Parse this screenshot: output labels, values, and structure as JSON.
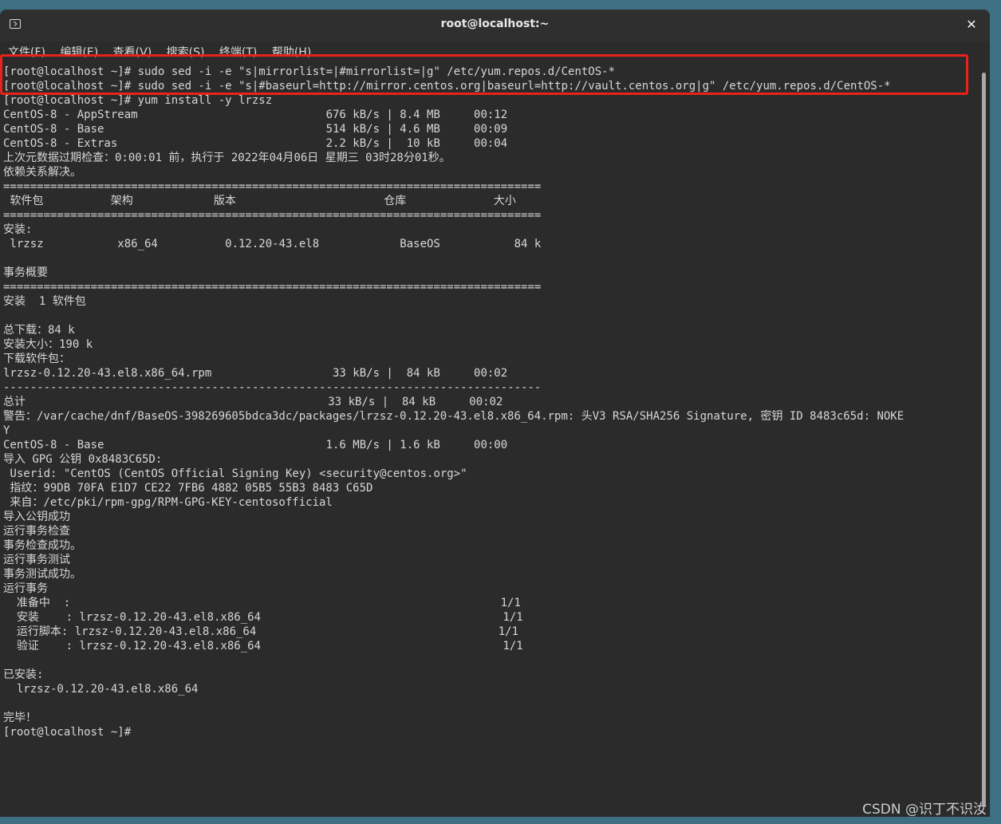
{
  "window": {
    "title": "root@localhost:~",
    "close_glyph": "✕"
  },
  "menu": [
    "文件(F)",
    "编辑(E)",
    "查看(V)",
    "搜索(S)",
    "终端(T)",
    "帮助(H)"
  ],
  "terminal": {
    "lines": [
      "[root@localhost ~]# sudo sed -i -e \"s|mirrorlist=|#mirrorlist=|g\" /etc/yum.repos.d/CentOS-*",
      "[root@localhost ~]# sudo sed -i -e \"s|#baseurl=http://mirror.centos.org|baseurl=http://vault.centos.org|g\" /etc/yum.repos.d/CentOS-*",
      "[root@localhost ~]# yum install -y lrzsz",
      "CentOS-8 - AppStream                            676 kB/s | 8.4 MB     00:12",
      "CentOS-8 - Base                                 514 kB/s | 4.6 MB     00:09",
      "CentOS-8 - Extras                               2.2 kB/s |  10 kB     00:04",
      "上次元数据过期检查：0:00:01 前，执行于 2022年04月06日 星期三 03时28分01秒。",
      "依赖关系解决。",
      "================================================================================",
      " 软件包          架构            版本                      仓库             大小",
      "================================================================================",
      "安装:",
      " lrzsz           x86_64          0.12.20-43.el8            BaseOS           84 k",
      "",
      "事务概要",
      "================================================================================",
      "安装  1 软件包",
      "",
      "总下载：84 k",
      "安装大小：190 k",
      "下载软件包：",
      "lrzsz-0.12.20-43.el8.x86_64.rpm                  33 kB/s |  84 kB     00:02",
      "--------------------------------------------------------------------------------",
      "总计                                             33 kB/s |  84 kB     00:02",
      "警告：/var/cache/dnf/BaseOS-398269605bdca3dc/packages/lrzsz-0.12.20-43.el8.x86_64.rpm: 头V3 RSA/SHA256 Signature, 密钥 ID 8483c65d: NOKE",
      "Y",
      "CentOS-8 - Base                                 1.6 MB/s | 1.6 kB     00:00",
      "导入 GPG 公钥 0x8483C65D:",
      " Userid: \"CentOS (CentOS Official Signing Key) <security@centos.org>\"",
      " 指纹：99DB 70FA E1D7 CE22 7FB6 4882 05B5 55B3 8483 C65D",
      " 来自：/etc/pki/rpm-gpg/RPM-GPG-KEY-centosofficial",
      "导入公钥成功",
      "运行事务检查",
      "事务检查成功。",
      "运行事务测试",
      "事务测试成功。",
      "运行事务",
      "  准备中  :                                                                1/1",
      "  安装    : lrzsz-0.12.20-43.el8.x86_64                                    1/1",
      "  运行脚本: lrzsz-0.12.20-43.el8.x86_64                                    1/1",
      "  验证    : lrzsz-0.12.20-43.el8.x86_64                                    1/1",
      "",
      "已安装:",
      "  lrzsz-0.12.20-43.el8.x86_64",
      "",
      "完毕！",
      "[root@localhost ~]# "
    ]
  },
  "watermark": "CSDN @识丁不识汝",
  "colors": {
    "terminal_bg": "#2b2b2b",
    "terminal_fg": "#d7d7d7",
    "highlight": "#e8231c",
    "desktop": "#3e6f82"
  }
}
